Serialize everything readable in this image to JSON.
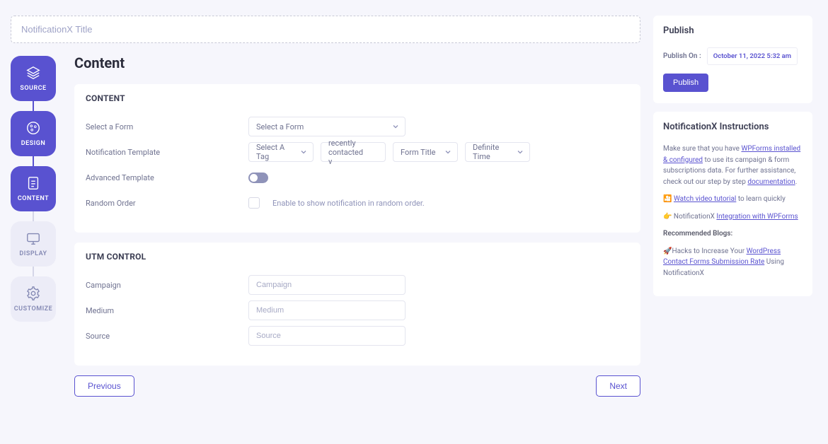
{
  "title_placeholder": "NotificationX Title",
  "steps": [
    {
      "label": "SOURCE"
    },
    {
      "label": "DESIGN"
    },
    {
      "label": "CONTENT"
    },
    {
      "label": "DISPLAY"
    },
    {
      "label": "CUSTOMIZE"
    }
  ],
  "page_heading": "Content",
  "content_section": {
    "title": "CONTENT",
    "select_form_label": "Select a Form",
    "select_form_value": "Select a Form",
    "template_label": "Notification Template",
    "template_tag": "Select A Tag",
    "template_recent": "recently contacted v",
    "template_formtitle": "Form Title",
    "template_time": "Definite Time",
    "advanced_label": "Advanced Template",
    "random_label": "Random Order",
    "random_desc": "Enable to show notification in random order."
  },
  "utm_section": {
    "title": "UTM CONTROL",
    "campaign_label": "Campaign",
    "campaign_placeholder": "Campaign",
    "medium_label": "Medium",
    "medium_placeholder": "Medium",
    "source_label": "Source",
    "source_placeholder": "Source"
  },
  "nav": {
    "prev": "Previous",
    "next": "Next"
  },
  "publish": {
    "title": "Publish",
    "on_label": "Publish On :",
    "date": "October 11, 2022 5:32 am",
    "btn": "Publish"
  },
  "instructions": {
    "title": "NotificationX Instructions",
    "p1_a": "Make sure that you have ",
    "p1_link1": "WPForms installed & configured",
    "p1_b": " to use its campaign & form subscriptions data. For further assistance, check out our step by step ",
    "p1_link2": "documentation",
    "p1_c": ".",
    "p2_icon": "🎦",
    "p2_a": " ",
    "p2_link": "Watch video tutorial",
    "p2_b": " to learn quickly",
    "p3_icon": "👉",
    "p3_a": " NotificationX ",
    "p3_link": "Integration with WPForms",
    "p4_label": "Recommended Blogs:",
    "p5_icon": "🚀",
    "p5_a": "Hacks to Increase Your ",
    "p5_link": "WordPress Contact Forms Submission Rate",
    "p5_b": " Using NotificationX"
  }
}
